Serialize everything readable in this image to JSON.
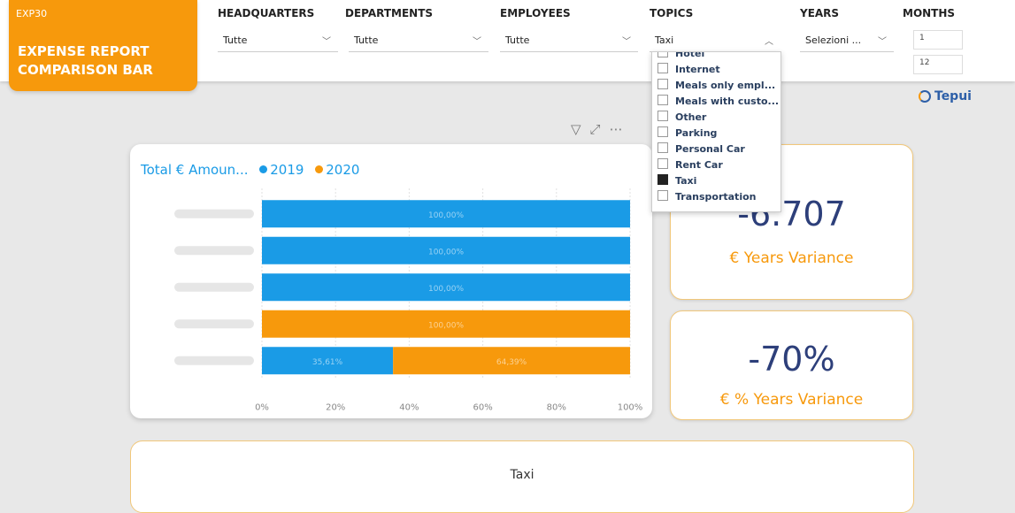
{
  "title_card": {
    "code": "EXP30",
    "title_line1": "EXPENSE REPORT",
    "title_line2": "COMPARISON BAR"
  },
  "filters": {
    "headquarters": {
      "label": "HEADQUARTERS",
      "value": "Tutte"
    },
    "departments": {
      "label": "DEPARTMENTS",
      "value": "Tutte"
    },
    "employees": {
      "label": "EMPLOYEES",
      "value": "Tutte"
    },
    "topics": {
      "label": "TOPICS",
      "value": "Taxi"
    },
    "years": {
      "label": "YEARS",
      "value": "Selezioni ..."
    },
    "months": {
      "label": "MONTHS",
      "from": "1",
      "to": "12"
    }
  },
  "topics_dropdown": {
    "items": [
      {
        "label": "Hotel",
        "checked": false
      },
      {
        "label": "Internet",
        "checked": false
      },
      {
        "label": "Meals only empl...",
        "checked": false
      },
      {
        "label": "Meals with custo...",
        "checked": false
      },
      {
        "label": "Other",
        "checked": false
      },
      {
        "label": "Parking",
        "checked": false
      },
      {
        "label": "Personal Car",
        "checked": false
      },
      {
        "label": "Rent Car",
        "checked": false
      },
      {
        "label": "Taxi",
        "checked": true
      },
      {
        "label": "Transportation",
        "checked": false
      }
    ]
  },
  "brand": {
    "name": "Tepui"
  },
  "chart_data": {
    "type": "bar",
    "orientation": "horizontal",
    "stacked": "100%",
    "title": "Total € Amoun...",
    "series": [
      {
        "name": "2019",
        "color": "#1a9be6",
        "values": [
          100,
          100,
          100,
          0,
          35.61
        ]
      },
      {
        "name": "2020",
        "color": "#f7990c",
        "values": [
          0,
          0,
          0,
          100,
          64.39
        ]
      }
    ],
    "data_labels": [
      "100,00%",
      "100,00%",
      "100,00%",
      "100,00%",
      "35,61%",
      "64,39%"
    ],
    "xlim": [
      0,
      100
    ],
    "xticks": [
      "0%",
      "20%",
      "40%",
      "60%",
      "80%",
      "100%"
    ],
    "legend_position": "top"
  },
  "kpis": {
    "variance": {
      "value": "-6.707",
      "label": "€ Years Variance"
    },
    "variance_pct": {
      "value": "-70%",
      "label": "€ % Years Variance"
    }
  },
  "bottom": {
    "label": "Taxi"
  }
}
